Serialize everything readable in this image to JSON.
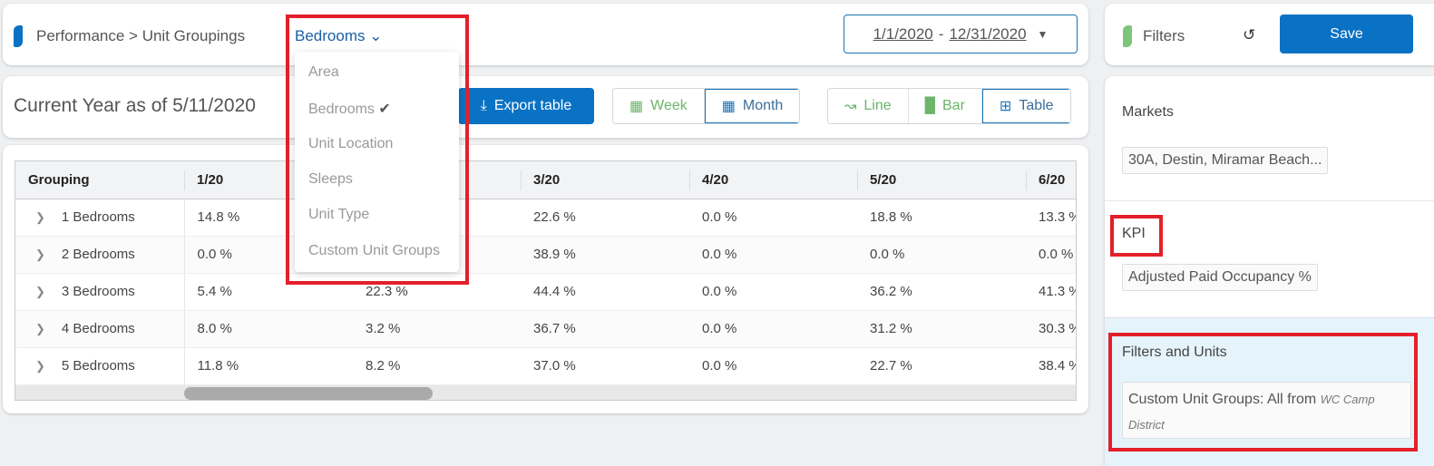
{
  "header": {
    "breadcrumb": "Performance > Unit Groupings",
    "grouping_selected": "Bedrooms",
    "date_start": "1/1/2020",
    "date_sep": "-",
    "date_end": "12/31/2020"
  },
  "toolbar": {
    "title": "Current Year as of 5/11/2020",
    "export_label": "Export table",
    "period": [
      {
        "label": "Week",
        "active": false
      },
      {
        "label": "Month",
        "active": true
      }
    ],
    "views": [
      {
        "label": "Line",
        "active": false
      },
      {
        "label": "Bar",
        "active": false
      },
      {
        "label": "Table",
        "active": true
      }
    ]
  },
  "dropdown": {
    "items": [
      {
        "label": "Area"
      },
      {
        "label": "Bedrooms",
        "checked": true
      },
      {
        "label": "Unit Location"
      },
      {
        "label": "Sleeps"
      },
      {
        "label": "Unit Type"
      },
      {
        "label": "Custom Unit Groups"
      }
    ]
  },
  "table": {
    "columns": [
      "Grouping",
      "1/20",
      "",
      "3/20",
      "4/20",
      "5/20",
      "6/20"
    ],
    "rows": [
      {
        "name": "1 Bedrooms",
        "values": [
          "14.8 %",
          "",
          "22.6 %",
          "0.0 %",
          "18.8 %",
          "13.3 %"
        ]
      },
      {
        "name": "2 Bedrooms",
        "values": [
          "0.0 %",
          "",
          "38.9 %",
          "0.0 %",
          "0.0 %",
          "0.0 %"
        ]
      },
      {
        "name": "3 Bedrooms",
        "values": [
          "5.4 %",
          "22.3 %",
          "44.4 %",
          "0.0 %",
          "36.2 %",
          "41.3 %"
        ]
      },
      {
        "name": "4 Bedrooms",
        "values": [
          "8.0 %",
          "3.2 %",
          "36.7 %",
          "0.0 %",
          "31.2 %",
          "30.3 %"
        ]
      },
      {
        "name": "5 Bedrooms",
        "values": [
          "11.8 %",
          "8.2 %",
          "37.0 %",
          "0.0 %",
          "22.7 %",
          "38.4 %"
        ]
      }
    ]
  },
  "filters": {
    "title": "Filters",
    "save_label": "Save",
    "markets_label": "Markets",
    "markets_value": "30A, Destin, Miramar Beach...",
    "kpi_label": "KPI",
    "kpi_value": "Adjusted Paid Occupancy %",
    "units_label": "Filters and Units",
    "units_value": "Custom Unit Groups: All from",
    "units_value_italic": "WC Camp District"
  },
  "colors": {
    "primary": "#0a72c4",
    "green": "#6cb56a",
    "highlight": "#e3202a",
    "panel_highlight": "#e5f4fb"
  }
}
